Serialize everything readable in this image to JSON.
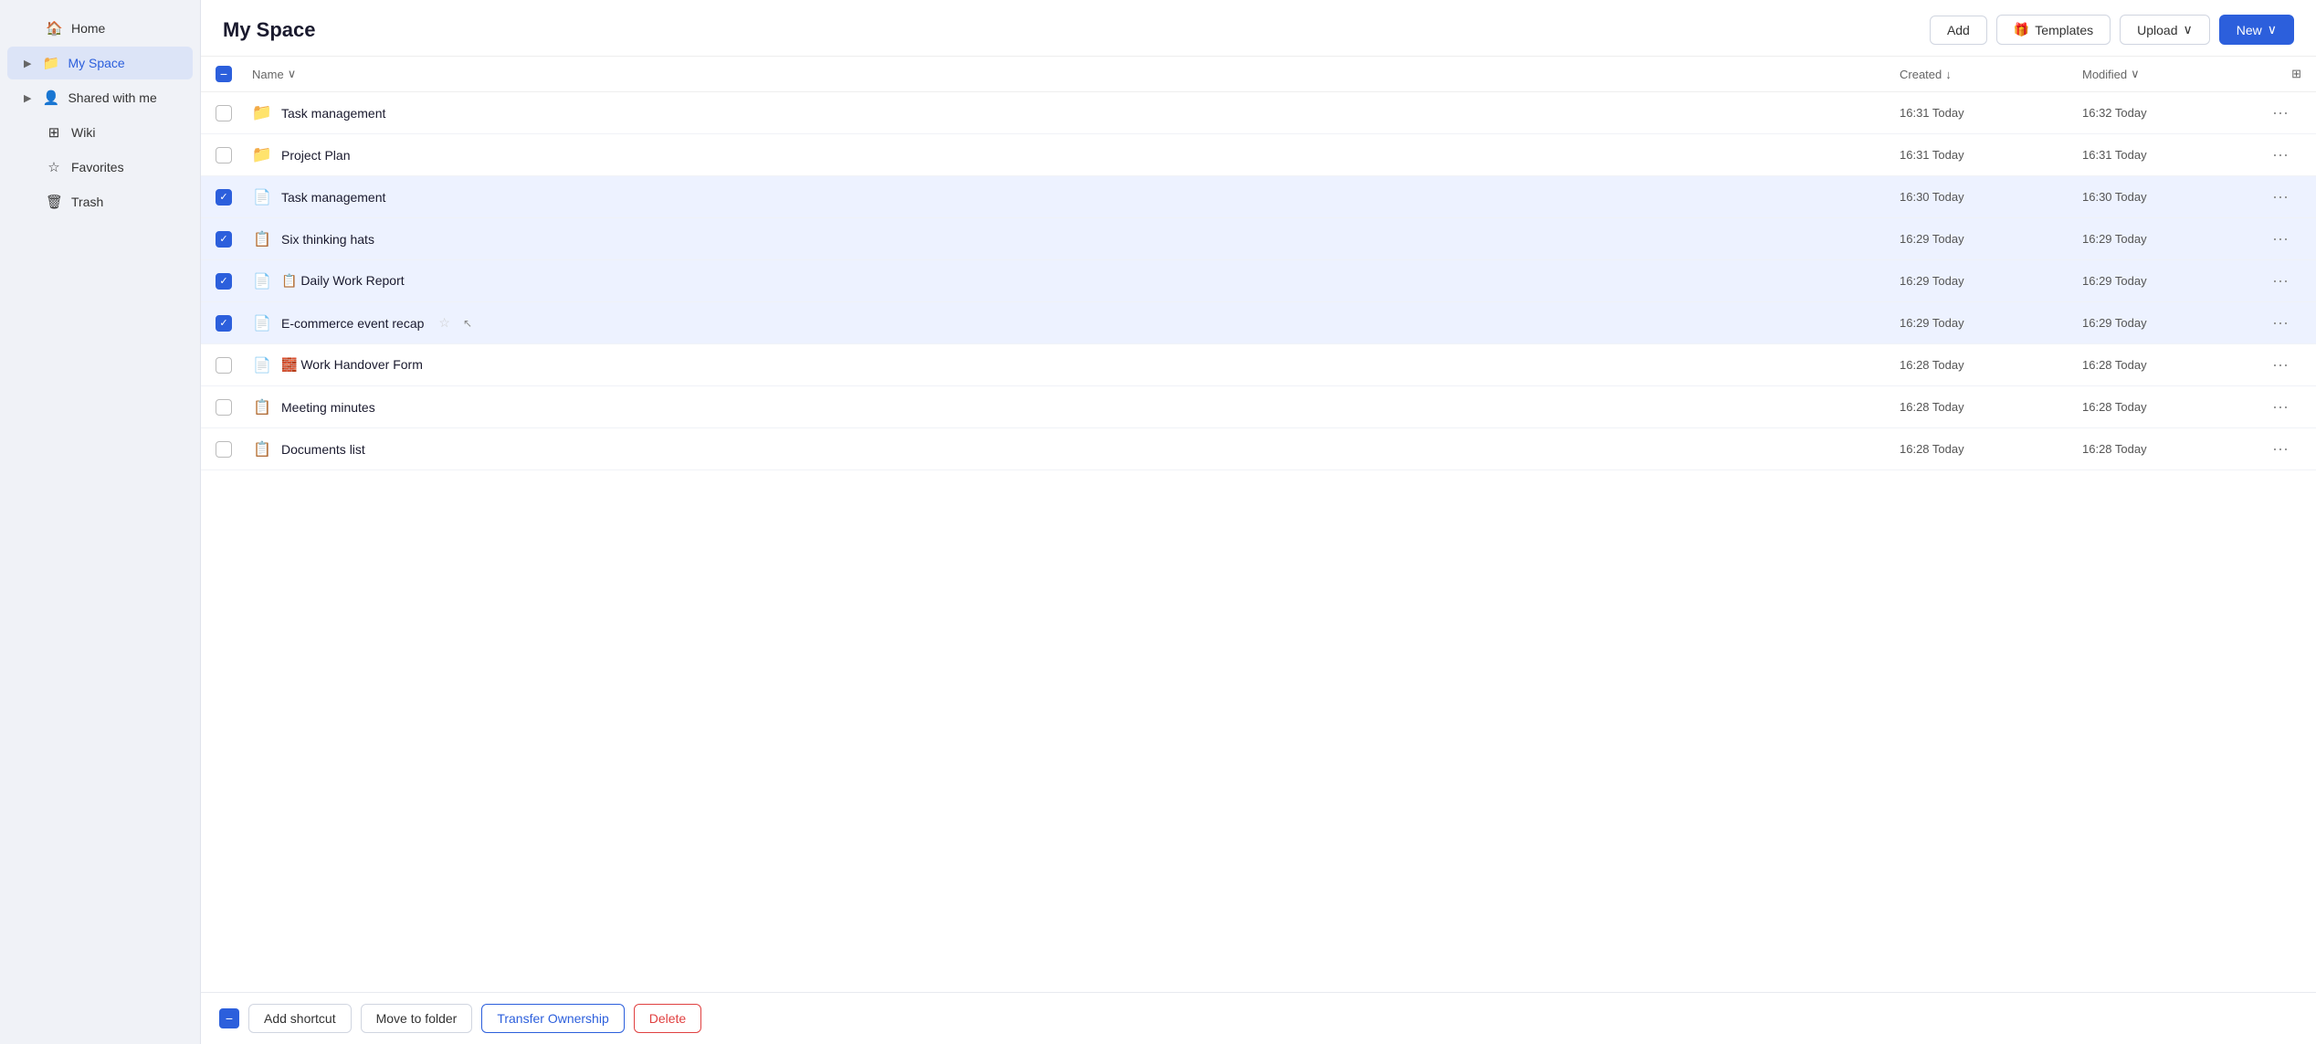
{
  "sidebar": {
    "items": [
      {
        "id": "home",
        "label": "Home",
        "icon": "🏠",
        "arrow": "",
        "active": false
      },
      {
        "id": "myspace",
        "label": "My Space",
        "icon": "📁",
        "arrow": "▶",
        "active": true
      },
      {
        "id": "shared",
        "label": "Shared with me",
        "icon": "👤",
        "arrow": "▶",
        "active": false
      },
      {
        "id": "wiki",
        "label": "Wiki",
        "icon": "⊞",
        "arrow": "",
        "active": false
      },
      {
        "id": "favorites",
        "label": "Favorites",
        "icon": "☆",
        "arrow": "",
        "active": false
      },
      {
        "id": "trash",
        "label": "Trash",
        "icon": "🗑",
        "arrow": "",
        "active": false
      }
    ]
  },
  "header": {
    "title": "My Space",
    "add_label": "Add",
    "templates_label": "Templates",
    "templates_emoji": "🎁",
    "upload_label": "Upload",
    "new_label": "New"
  },
  "table": {
    "col_name": "Name",
    "col_created": "Created",
    "col_modified": "Modified",
    "sort_asc": "↓",
    "sort_chevron": "∨",
    "rows": [
      {
        "id": 1,
        "name": "Task management",
        "type": "folder",
        "created": "16:31 Today",
        "modified": "16:32 Today",
        "selected": false,
        "starred": false
      },
      {
        "id": 2,
        "name": "Project Plan",
        "type": "folder",
        "created": "16:31 Today",
        "modified": "16:31 Today",
        "selected": false,
        "starred": false
      },
      {
        "id": 3,
        "name": "Task management",
        "type": "doc-blue",
        "created": "16:30 Today",
        "modified": "16:30 Today",
        "selected": true,
        "starred": false
      },
      {
        "id": 4,
        "name": "Six thinking hats",
        "type": "doc-teal",
        "created": "16:29 Today",
        "modified": "16:29 Today",
        "selected": true,
        "starred": false
      },
      {
        "id": 5,
        "name": "📋 Daily Work Report",
        "type": "doc-blue",
        "created": "16:29 Today",
        "modified": "16:29 Today",
        "selected": true,
        "starred": false
      },
      {
        "id": 6,
        "name": "E-commerce event recap",
        "type": "doc-blue",
        "created": "16:29 Today",
        "modified": "16:29 Today",
        "selected": true,
        "starred": true
      },
      {
        "id": 7,
        "name": "🧱 Work Handover Form",
        "type": "doc-blue",
        "created": "16:28 Today",
        "modified": "16:28 Today",
        "selected": false,
        "starred": false
      },
      {
        "id": 8,
        "name": "Meeting minutes",
        "type": "doc-teal",
        "created": "16:28 Today",
        "modified": "16:28 Today",
        "selected": false,
        "starred": false
      },
      {
        "id": 9,
        "name": "Documents list",
        "type": "doc-teal",
        "created": "16:28 Today",
        "modified": "16:28 Today",
        "selected": false,
        "starred": false
      }
    ]
  },
  "bottom_bar": {
    "add_shortcut_label": "Add shortcut",
    "move_to_folder_label": "Move to folder",
    "transfer_ownership_label": "Transfer Ownership",
    "delete_label": "Delete"
  }
}
